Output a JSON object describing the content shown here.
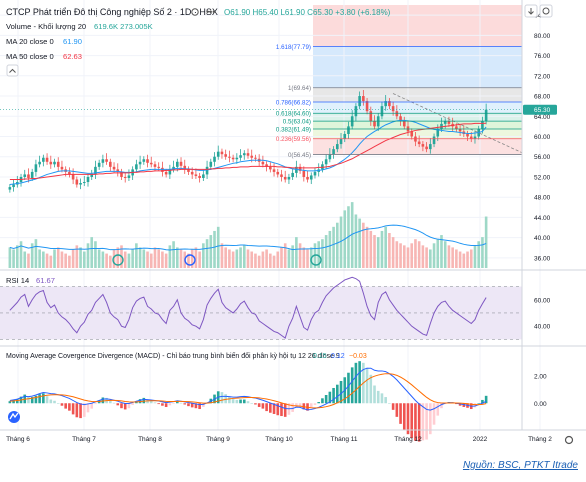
{
  "header": {
    "title": "CTCP Phát triển Đô thị Công nghiệp Số 2 · 1D · HSX",
    "ohlc": "O61.90 H65.40 L61.90 C65.30 +3.80 (+6.18%)",
    "volume_label": "Volume - Khối lượng 20",
    "volume_values": "619.6K 273.005K",
    "ma20_label": "MA 20 close 0",
    "ma20_value": "61.90",
    "ma50_label": "MA 50 close 0",
    "ma50_value": "62.63"
  },
  "rsi": {
    "label": "RSI 14",
    "value": "61.67"
  },
  "macd": {
    "label": "Moving Average Covergence Divergence (MACD) - Chỉ báo trung bình biến đổi phân kỳ hội tụ 12 26 close 9",
    "v1": "0.15",
    "v2": "0.12",
    "v3": "−0.03"
  },
  "source": "Nguồn: BSC, PTKT Itrade",
  "colors": {
    "up": "#26a69a",
    "down": "#ef5350",
    "ma20": "#2196f3",
    "ma50": "#f23645",
    "rsi": "#7e57c2",
    "macd_line": "#2962ff",
    "signal_line": "#ff6d00"
  },
  "chart_data": {
    "type": "candlestick",
    "x_labels": [
      "Tháng 6",
      "Tháng 7",
      "Tháng 8",
      "Tháng 9",
      "Tháng 10",
      "Tháng 11",
      "Tháng 12",
      "2022",
      "Tháng 2"
    ],
    "price_axis": [
      "84.00",
      "80.00",
      "76.00",
      "72.00",
      "68.00",
      "64.00",
      "60.00",
      "56.00",
      "52.00",
      "48.00",
      "44.00",
      "40.00",
      "36.00"
    ],
    "price_ylim": [
      34,
      86
    ],
    "last_price": "65.30",
    "fibonacci": [
      {
        "label": "1.618(77.79)",
        "value": 77.79
      },
      {
        "label": "1(69.64)",
        "value": 69.64
      },
      {
        "label": "0.786(66.82)",
        "value": 66.82
      },
      {
        "label": "0.618(64.60)",
        "value": 64.6
      },
      {
        "label": "0.5(63.04)",
        "value": 63.04
      },
      {
        "label": "0.382(61.49)",
        "value": 61.49
      },
      {
        "label": "0.236(59.56)",
        "value": 59.56
      },
      {
        "label": "0(56.45)",
        "value": 56.45
      }
    ],
    "close": [
      50,
      50.5,
      51,
      52,
      52.5,
      51.8,
      53,
      54.5,
      55,
      55.8,
      55,
      54.5,
      55,
      54,
      53.5,
      53,
      52.5,
      51.5,
      50.5,
      50.8,
      51,
      52,
      52.5,
      54,
      54.8,
      55.5,
      55,
      54,
      53.5,
      53,
      52,
      51.8,
      52.3,
      53.5,
      54.5,
      55,
      55.5,
      54.8,
      54.5,
      54,
      53.8,
      53,
      52.5,
      53.5,
      54,
      55,
      54.2,
      53.5,
      53,
      52.5,
      52.2,
      51.8,
      52.5,
      54,
      55,
      56,
      57,
      56.5,
      56,
      55.8,
      55.5,
      55.8,
      56.3,
      56.7,
      56.2,
      55.8,
      55.6,
      55,
      54.5,
      54,
      53.5,
      53,
      52.5,
      52,
      51.5,
      52,
      52.8,
      54,
      53.2,
      52,
      51.5,
      52.3,
      53,
      53.5,
      54.5,
      55.5,
      56.5,
      57.5,
      58.5,
      59.5,
      60.5,
      62,
      64,
      66,
      68,
      67,
      65,
      63,
      62,
      64,
      66,
      67,
      66,
      65,
      64,
      63,
      62,
      61,
      60,
      59,
      58.5,
      58,
      57.5,
      58.5,
      60,
      61.5,
      62.5,
      63,
      62.5,
      62,
      61.5,
      61,
      60.5,
      60,
      59.5,
      60,
      61.5,
      63,
      65.3
    ],
    "ma20": [
      50.5,
      50.6,
      50.7,
      50.8,
      51,
      51.2,
      51.4,
      51.6,
      51.9,
      52.2,
      52.5,
      52.7,
      52.9,
      53.1,
      53.2,
      53.2,
      53.2,
      53.1,
      53,
      52.9,
      52.8,
      52.7,
      52.7,
      52.8,
      52.9,
      53,
      53.1,
      53.1,
      53.1,
      53.1,
      53,
      52.9,
      52.9,
      52.9,
      53,
      53.2,
      53.3,
      53.4,
      53.5,
      53.5,
      53.5,
      53.5,
      53.5,
      53.5,
      53.6,
      53.7,
      53.7,
      53.6,
      53.6,
      53.5,
      53.4,
      53.3,
      53.3,
      53.4,
      53.5,
      53.7,
      53.9,
      54.1,
      54.3,
      54.5,
      54.7,
      54.8,
      55,
      55.1,
      55.2,
      55.3,
      55.3,
      55.3,
      55.3,
      55.2,
      55,
      54.8,
      54.6,
      54.3,
      54,
      53.8,
      53.6,
      53.5,
      53.4,
      53.3,
      53.2,
      53.2,
      53.2,
      53.3,
      53.4,
      53.6,
      53.8,
      54.1,
      54.5,
      55,
      55.5,
      56.1,
      56.8,
      57.6,
      58.5,
      59.3,
      60,
      60.5,
      61,
      61.4,
      61.9,
      62.3,
      62.6,
      62.9,
      63.1,
      63.2,
      63.2,
      63.1,
      63,
      62.8,
      62.5,
      62.2,
      61.9,
      61.6,
      61.4,
      61.3,
      61.2,
      61.1,
      61,
      61,
      60.9,
      60.8,
      60.7,
      60.6,
      60.6,
      60.7,
      60.8,
      61,
      61.9
    ],
    "ma50": [
      51.5,
      51.5,
      51.5,
      51.5,
      51.6,
      51.6,
      51.7,
      51.7,
      51.8,
      51.9,
      52,
      52.1,
      52.2,
      52.3,
      52.4,
      52.5,
      52.5,
      52.5,
      52.5,
      52.5,
      52.5,
      52.5,
      52.5,
      52.5,
      52.6,
      52.6,
      52.7,
      52.7,
      52.8,
      52.8,
      52.8,
      52.8,
      52.8,
      52.9,
      52.9,
      53,
      53,
      53.1,
      53.1,
      53.2,
      53.2,
      53.2,
      53.3,
      53.3,
      53.4,
      53.4,
      53.5,
      53.5,
      53.5,
      53.5,
      53.5,
      53.5,
      53.5,
      53.5,
      53.6,
      53.6,
      53.7,
      53.7,
      53.8,
      53.8,
      53.9,
      53.9,
      54,
      54,
      54,
      54.1,
      54.1,
      54.1,
      54.1,
      54.1,
      54.1,
      54.1,
      54,
      54,
      53.9,
      53.9,
      53.8,
      53.8,
      53.8,
      53.8,
      53.8,
      53.8,
      53.8,
      53.9,
      53.9,
      54,
      54.1,
      54.3,
      54.5,
      54.7,
      55,
      55.3,
      55.6,
      56,
      56.4,
      56.8,
      57.2,
      57.6,
      58,
      58.4,
      58.8,
      59.2,
      59.5,
      59.8,
      60.1,
      60.4,
      60.6,
      60.8,
      61,
      61.2,
      61.3,
      61.4,
      61.5,
      61.6,
      61.7,
      61.8,
      61.9,
      62,
      62.1,
      62.2,
      62.3,
      62.4,
      62.5,
      62.5,
      62.5,
      62.6,
      62.6,
      62.6,
      62.63
    ],
    "volume_base": [
      1.0,
      0.9,
      1.1,
      1.3,
      0.8,
      0.7,
      1.2,
      1.4,
      0.9,
      0.8,
      0.7,
      0.6,
      0.9,
      1.0,
      0.8,
      0.7,
      0.6,
      0.9,
      1.1,
      1.0,
      0.8,
      1.2,
      1.5,
      1.3,
      0.9,
      0.8,
      0.7,
      0.6,
      0.9,
      1.0,
      1.1,
      0.8,
      0.7,
      0.9,
      1.2,
      1.0,
      0.9,
      0.8,
      0.7,
      1.0,
      0.9,
      0.8,
      0.7,
      1.1,
      1.3,
      1.0,
      0.9,
      0.8,
      0.7,
      0.9,
      1.0,
      0.8,
      1.2,
      1.4,
      1.6,
      1.8,
      2.0,
      1.2,
      1.0,
      0.9,
      0.8,
      0.9,
      1.0,
      1.1,
      0.9,
      0.8,
      0.7,
      0.6,
      0.8,
      0.9,
      0.7,
      0.6,
      0.8,
      1.0,
      1.2,
      0.9,
      1.1,
      1.5,
      1.2,
      1.0,
      0.9,
      1.0,
      1.2,
      1.3,
      1.4,
      1.6,
      1.8,
      2.0,
      2.2,
      2.5,
      2.8,
      3.0,
      3.2,
      2.6,
      2.4,
      2.2,
      2.0,
      1.8,
      1.6,
      1.5,
      1.8,
      2.0,
      1.7,
      1.5,
      1.3,
      1.2,
      1.1,
      1.0,
      1.2,
      1.4,
      1.3,
      1.1,
      1.0,
      0.9,
      1.2,
      1.4,
      1.6,
      1.3,
      1.1,
      1.0,
      0.9,
      0.8,
      0.7,
      0.8,
      0.9,
      1.1,
      1.3,
      1.5,
      2.5
    ],
    "rsi_axis": [
      "60.00",
      "40.00"
    ],
    "rsi_ylim": [
      28,
      78
    ],
    "rsi_band": [
      30,
      70
    ],
    "rsi": [
      52,
      55,
      58,
      62,
      64,
      55,
      60,
      64,
      66,
      67,
      58,
      54,
      56,
      50,
      47,
      45,
      42,
      38,
      35,
      40,
      43,
      49,
      52,
      58,
      61,
      64,
      58,
      50,
      47,
      45,
      40,
      39,
      45,
      54,
      59,
      61,
      62,
      55,
      53,
      50,
      49,
      45,
      42,
      52,
      55,
      60,
      50,
      46,
      44,
      41,
      40,
      38,
      45,
      56,
      61,
      65,
      68,
      58,
      54,
      52,
      50,
      53,
      57,
      59,
      54,
      50,
      49,
      44,
      42,
      40,
      38,
      36,
      35,
      33,
      31,
      40,
      46,
      55,
      47,
      39,
      37,
      45,
      50,
      52,
      58,
      63,
      66,
      69,
      71,
      73,
      75,
      76,
      77,
      76,
      74,
      65,
      55,
      48,
      45,
      58,
      64,
      66,
      60,
      56,
      52,
      49,
      46,
      43,
      40,
      38,
      36,
      34,
      33,
      42,
      50,
      55,
      58,
      59,
      55,
      52,
      50,
      48,
      46,
      44,
      42,
      45,
      52,
      57,
      61.67
    ],
    "macd_axis": [
      "2.00",
      "0.00"
    ],
    "macd_ylim": [
      -1.8,
      3.0
    ],
    "macd": [
      0.2,
      0.25,
      0.3,
      0.4,
      0.5,
      0.48,
      0.52,
      0.6,
      0.7,
      0.78,
      0.75,
      0.7,
      0.68,
      0.62,
      0.55,
      0.45,
      0.35,
      0.2,
      0.05,
      -0.05,
      -0.1,
      -0.05,
      0.0,
      0.1,
      0.2,
      0.3,
      0.32,
      0.28,
      0.22,
      0.15,
      0.05,
      -0.02,
      -0.02,
      0.05,
      0.15,
      0.22,
      0.28,
      0.26,
      0.24,
      0.2,
      0.16,
      0.1,
      0.05,
      0.08,
      0.12,
      0.18,
      0.15,
      0.1,
      0.05,
      0.0,
      -0.05,
      -0.1,
      -0.08,
      0.02,
      0.15,
      0.3,
      0.45,
      0.5,
      0.5,
      0.48,
      0.45,
      0.45,
      0.48,
      0.5,
      0.47,
      0.42,
      0.38,
      0.3,
      0.22,
      0.12,
      0.02,
      -0.08,
      -0.18,
      -0.28,
      -0.38,
      -0.4,
      -0.38,
      -0.28,
      -0.3,
      -0.4,
      -0.48,
      -0.45,
      -0.38,
      -0.3,
      -0.18,
      -0.05,
      0.1,
      0.28,
      0.48,
      0.7,
      0.95,
      1.25,
      1.6,
      1.95,
      2.25,
      2.45,
      2.55,
      2.55,
      2.4,
      2.35,
      2.35,
      2.3,
      2.15,
      1.95,
      1.7,
      1.4,
      1.1,
      0.8,
      0.5,
      0.2,
      -0.05,
      -0.25,
      -0.45,
      -0.5,
      -0.4,
      -0.25,
      -0.1,
      0.0,
      0.05,
      0.05,
      0.0,
      -0.05,
      -0.1,
      -0.15,
      -0.22,
      -0.2,
      -0.1,
      0.0,
      0.15
    ],
    "signal": [
      0.15,
      0.17,
      0.2,
      0.24,
      0.29,
      0.33,
      0.37,
      0.42,
      0.48,
      0.54,
      0.58,
      0.61,
      0.62,
      0.62,
      0.61,
      0.58,
      0.53,
      0.47,
      0.39,
      0.31,
      0.23,
      0.17,
      0.13,
      0.12,
      0.13,
      0.16,
      0.19,
      0.21,
      0.21,
      0.2,
      0.17,
      0.13,
      0.1,
      0.09,
      0.1,
      0.12,
      0.15,
      0.17,
      0.18,
      0.18,
      0.18,
      0.16,
      0.14,
      0.13,
      0.13,
      0.14,
      0.14,
      0.13,
      0.12,
      0.1,
      0.07,
      0.04,
      0.01,
      0.01,
      0.04,
      0.09,
      0.16,
      0.23,
      0.28,
      0.32,
      0.35,
      0.37,
      0.39,
      0.41,
      0.42,
      0.42,
      0.41,
      0.39,
      0.35,
      0.31,
      0.25,
      0.18,
      0.11,
      0.03,
      -0.05,
      -0.12,
      -0.17,
      -0.19,
      -0.21,
      -0.25,
      -0.3,
      -0.33,
      -0.34,
      -0.33,
      -0.3,
      -0.25,
      -0.18,
      -0.09,
      0.03,
      0.16,
      0.32,
      0.51,
      0.73,
      0.97,
      1.23,
      1.47,
      1.69,
      1.86,
      1.97,
      2.05,
      2.11,
      2.15,
      2.15,
      2.11,
      2.03,
      1.9,
      1.74,
      1.55,
      1.34,
      1.11,
      0.88,
      0.65,
      0.43,
      0.25,
      0.12,
      0.05,
      0.02,
      0.02,
      0.02,
      0.03,
      0.02,
      0.01,
      -0.01,
      -0.04,
      -0.08,
      -0.1,
      -0.1,
      -0.08,
      -0.03
    ]
  }
}
